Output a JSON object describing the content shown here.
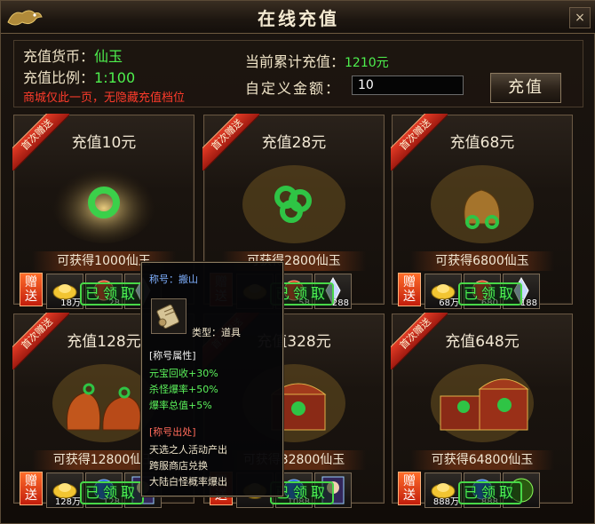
{
  "window": {
    "title": "在线充值",
    "close_label": "×"
  },
  "info": {
    "currency_label": "充值货币：",
    "currency_value": "仙玉",
    "ratio_label": "充值比例：",
    "ratio_value": "1:100",
    "notice": "商城仅此一页，无隐藏充值档位",
    "total_label": "当前累计充值：",
    "total_value": "1210元",
    "custom_label": "自定义金额：",
    "custom_value": "10",
    "recharge_button": "充值"
  },
  "cards": [
    {
      "badge": "首次赠送",
      "title": "充值10元",
      "gain": "可获得1000仙玉",
      "gift": "赠送",
      "counts": [
        "18万",
        "28",
        ""
      ],
      "claimed": "已领取"
    },
    {
      "badge": "首次赠送",
      "title": "充值28元",
      "gain": "可获得2800仙玉",
      "gift": "赠送",
      "counts": [
        "",
        "58",
        "288"
      ],
      "claimed": "已领取"
    },
    {
      "badge": "首次赠送",
      "title": "充值68元",
      "gain": "可获得6800仙玉",
      "gift": "赠送",
      "counts": [
        "68万",
        "680",
        "188"
      ],
      "claimed": "已领取"
    },
    {
      "badge": "首次赠送",
      "title": "充值128元",
      "gain": "可获得12800仙玉",
      "gift": "赠送",
      "counts": [
        "128万",
        "128",
        ""
      ],
      "claimed": "已领取"
    },
    {
      "badge": "首次赠送",
      "title": "充值328元",
      "gain": "可获得32800仙玉",
      "gift": "赠送",
      "counts": [
        "",
        "1088",
        ""
      ],
      "claimed": "已领取"
    },
    {
      "badge": "首次赠送",
      "title": "充值648元",
      "gain": "可获得64800仙玉",
      "gift": "赠送",
      "counts": [
        "888万",
        "888",
        ""
      ],
      "claimed": "已领取"
    }
  ],
  "tooltip": {
    "name": "称号：搬山",
    "type": "类型：道具",
    "attr_header": "[称号属性]",
    "attrs": [
      "元宝回收+30%",
      "杀怪爆率+50%",
      "爆率总值+5%"
    ],
    "source_header": "[称号出处]",
    "sources": [
      "天选之人活动产出",
      "跨服商店兑换",
      "大陆白怪概率爆出"
    ]
  },
  "colors": {
    "accent_green": "#4ef04e",
    "notice_red": "#ff3b2b",
    "ribbon_red": "#c2281a"
  },
  "icons": [
    "dragon-logo",
    "close-icon",
    "jade-ring",
    "jade-bag",
    "treasure-chest",
    "gold-ingot",
    "red-orb",
    "blue-orb",
    "crystal",
    "character-portrait",
    "green-flame",
    "scroll-icon"
  ]
}
